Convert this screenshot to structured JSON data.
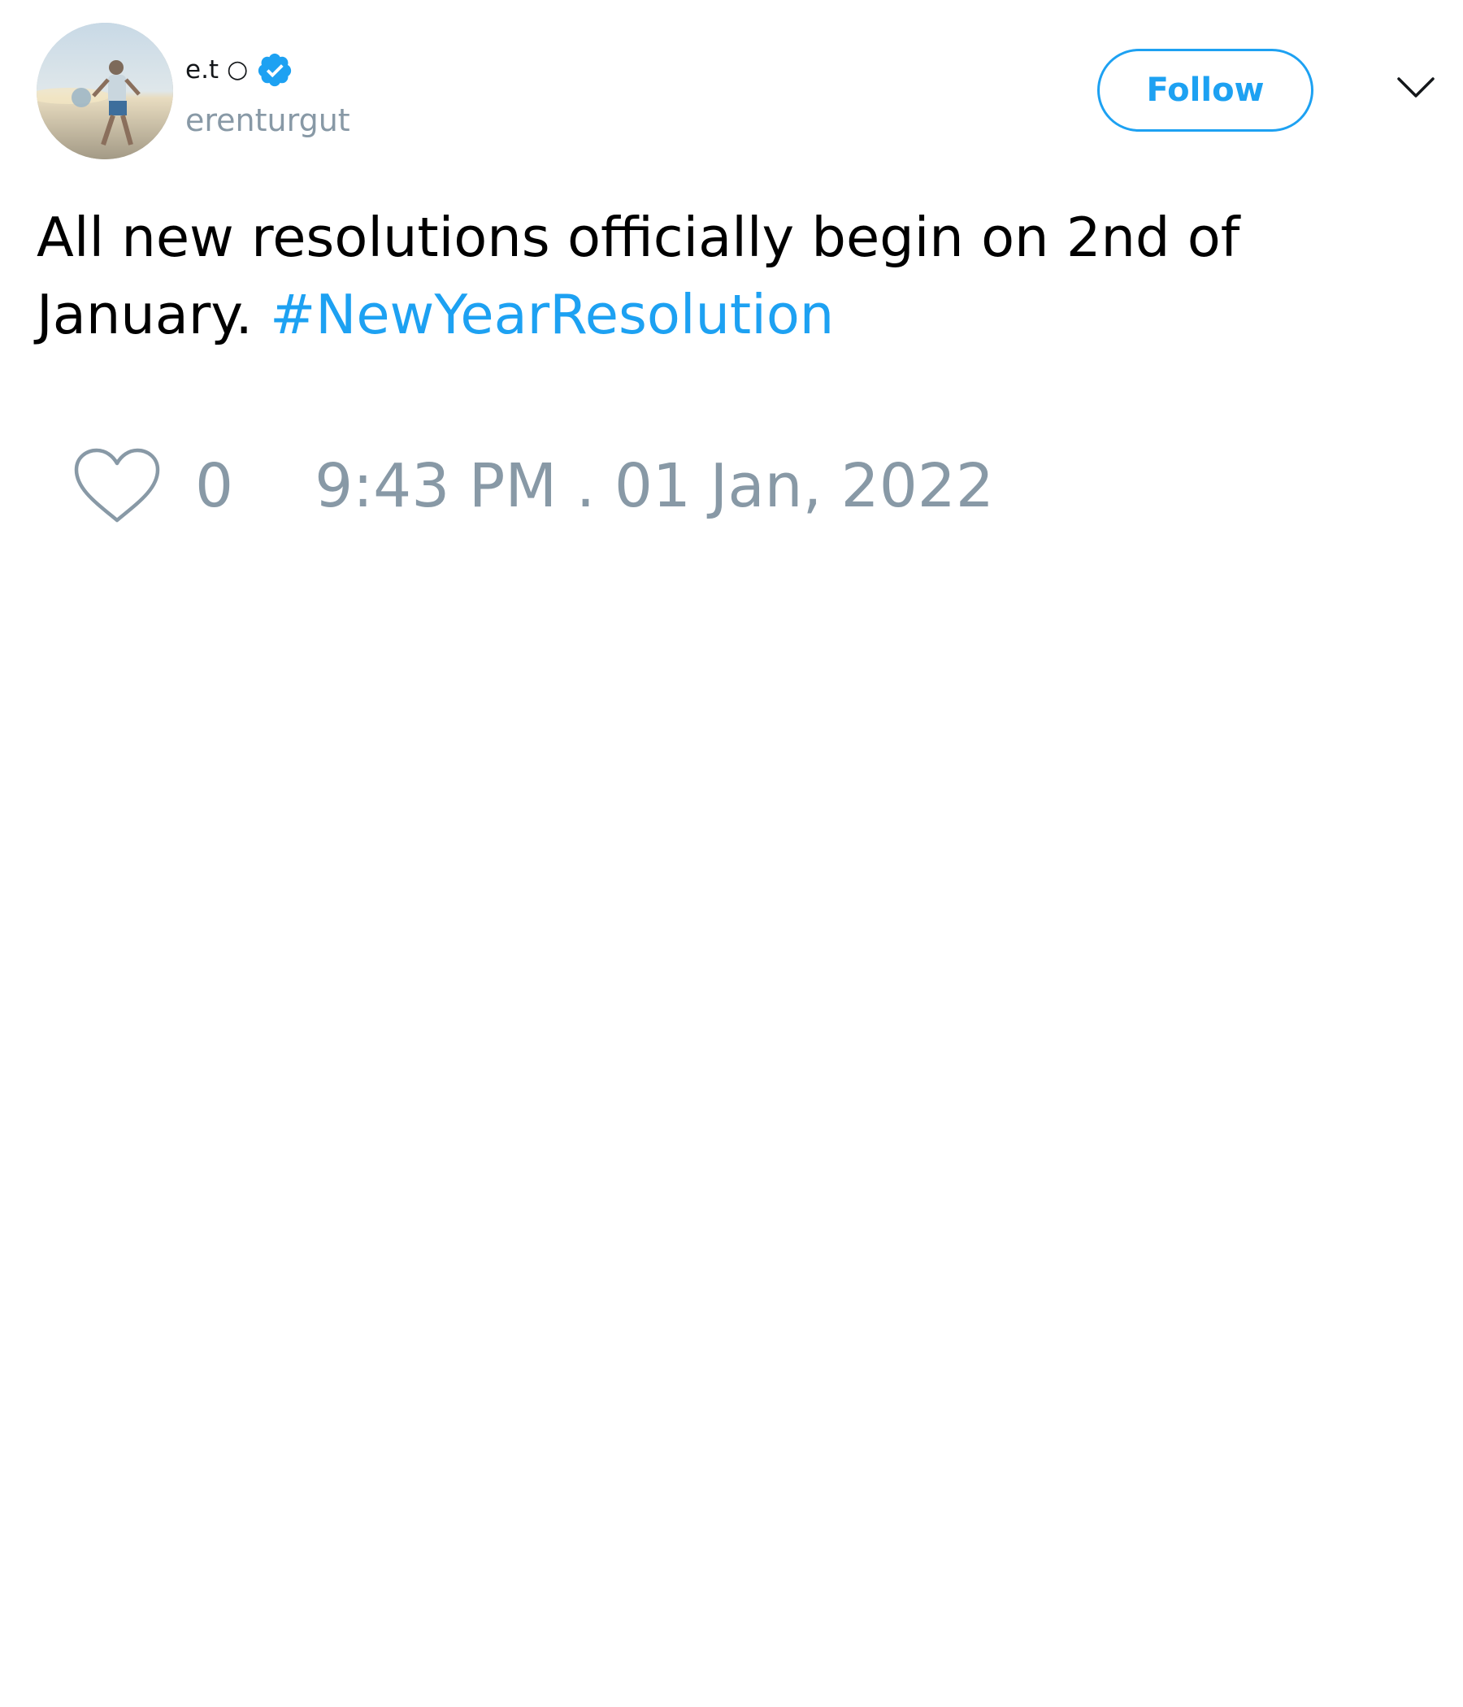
{
  "tweet": {
    "author": {
      "display_name": "e.t",
      "name_symbol": "○",
      "username": "erenturgut",
      "verified": true,
      "avatar_icon": "profile-photo"
    },
    "follow_label": "Follow",
    "menu_icon": "chevron-down-icon",
    "text": "All new resolutions officially begin on 2nd of January.",
    "hashtag": "#NewYearResolution",
    "like_icon": "heart-outline-icon",
    "like_count": "0",
    "timestamp": "9:43 PM . 01 Jan, 2022"
  },
  "colors": {
    "accent": "#1da1f2",
    "muted": "#8899a6",
    "text": "#000000",
    "background": "#ffffff"
  }
}
